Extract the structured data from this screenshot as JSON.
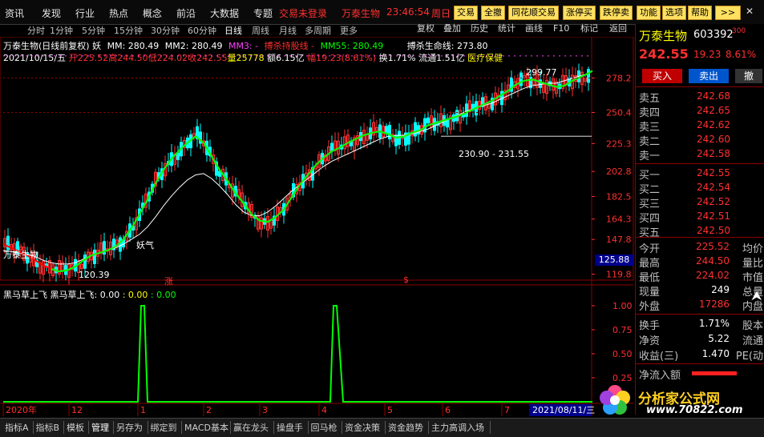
{
  "menu": {
    "items": [
      "资讯",
      "发现",
      "行业",
      "热点",
      "概念",
      "前沿",
      "大数据",
      "专题"
    ],
    "login_status": "交易未登录",
    "stock_name": "万泰生物",
    "clock": "23:46:54",
    "weekday": "周日",
    "buttons": [
      "交易",
      "全撤",
      "同花顺交易",
      "涨停买",
      "跌停卖",
      "功能",
      "选项",
      "帮助",
      ">>"
    ]
  },
  "periods": {
    "items": [
      "分时",
      "1分钟",
      "5分钟",
      "15分钟",
      "30分钟",
      "60分钟",
      "日线",
      "周线",
      "月线",
      "多周期",
      "更多"
    ],
    "selected": "日线"
  },
  "toolbar": {
    "buttons": [
      "复权",
      "叠加",
      "历史",
      "统计",
      "画线",
      "F10",
      "标记",
      "返回"
    ]
  },
  "main_info": {
    "title": "万泰生物(日线前复权)",
    "kind_glyph": "妖",
    "ma1": "MM: 280.49",
    "ma2": "MM2: 280.49",
    "ma3_label": "MM3: -",
    "ma3_text": "搏杀持股线 -",
    "ma55": "MM55: 280.49",
    "life_line": "搏杀生命线: 273.80",
    "date": "2021/10/15/五",
    "open": "开225.52",
    "high": "高244.50",
    "low": "低224.02",
    "close": "收242.55",
    "volume": "量25778",
    "amount": "额6.15亿",
    "amp": "幅19.23(8.61%)",
    "turnover": "换1.71%",
    "float": "流通1.51亿",
    "sector": "医疗保健"
  },
  "annotations": {
    "high_label": "299.77",
    "range_label": "230.90 - 231.55",
    "low_label": "120.39",
    "yao_label": "妖气",
    "marker1": "涨",
    "marker2": "$",
    "current_price_tag": "125.88"
  },
  "indicator": {
    "title": "黑马草上飞 黑马草上飞: 0.00",
    "v1": ": 0.00",
    "v2": ": 0.00"
  },
  "xaxis": {
    "labels": [
      "2020年",
      "12",
      "1",
      "2",
      "3",
      "4",
      "5",
      "6",
      "7"
    ],
    "current_date": "2021/08/11/三"
  },
  "chart_data": [
    {
      "type": "candlestick",
      "title": "万泰生物(日线前复权)",
      "ylim": [
        115,
        305
      ],
      "yticks": [
        278.2,
        250.4,
        225.3,
        202.8,
        182.5,
        164.3,
        147.8,
        119.8
      ],
      "series": [
        {
          "name": "MM2",
          "type": "line",
          "color": "#ffffff",
          "x": [
            0,
            10,
            20,
            30,
            40,
            50,
            60,
            70,
            80,
            90,
            100,
            110,
            120,
            130,
            140,
            150,
            160,
            170,
            180,
            190,
            200,
            210,
            220,
            230,
            240,
            250,
            260,
            270,
            280,
            290,
            300,
            310,
            320,
            330,
            340,
            350,
            360,
            370,
            380,
            390,
            400,
            410,
            420,
            430,
            440,
            450,
            460,
            470,
            480,
            490,
            500,
            510,
            520,
            530,
            540,
            550,
            560,
            570,
            580,
            590,
            600,
            610,
            620,
            630,
            640,
            650,
            660,
            670,
            680,
            690,
            700,
            710,
            720,
            730,
            735
          ],
          "values": [
            139,
            138,
            137,
            136,
            134,
            131,
            129,
            128,
            128,
            129,
            132,
            135,
            137,
            139,
            141,
            144,
            148,
            152,
            158,
            166,
            175,
            183,
            190,
            196,
            200,
            201,
            197,
            191,
            184,
            176,
            170,
            167,
            167,
            170,
            175,
            181,
            187,
            192,
            197,
            202,
            207,
            211,
            214,
            217,
            220,
            223,
            226,
            229,
            231,
            232,
            232,
            233,
            235,
            237,
            240,
            243,
            246,
            249,
            252,
            254,
            256,
            258,
            261,
            264,
            267,
            270,
            272,
            273,
            274,
            274,
            276,
            278,
            280,
            282,
            284
          ]
        },
        {
          "name": "MM",
          "type": "line",
          "color": "#ff0000",
          "x": [
            0,
            10,
            20,
            30,
            40,
            50,
            60,
            70,
            80,
            90,
            100,
            110,
            120,
            130,
            140,
            150,
            160,
            170,
            180,
            190,
            200,
            210,
            220,
            230,
            240,
            250,
            260,
            270,
            280,
            290,
            300,
            310,
            320,
            330,
            340,
            350,
            360,
            370,
            380,
            390,
            400,
            410,
            420,
            430,
            440,
            450,
            460,
            470,
            480,
            490,
            500,
            510,
            520,
            530,
            540,
            550,
            560,
            570,
            580,
            590,
            600,
            610,
            620,
            630,
            640,
            650,
            660,
            670,
            680,
            690,
            700,
            710,
            720,
            730,
            735
          ],
          "values": [
            144,
            141,
            138,
            135,
            131,
            127,
            124,
            122,
            123,
            126,
            131,
            135,
            137,
            139,
            142,
            148,
            157,
            168,
            180,
            193,
            204,
            213,
            220,
            226,
            231,
            226,
            215,
            204,
            195,
            185,
            177,
            168,
            163,
            162,
            166,
            172,
            182,
            192,
            200,
            208,
            214,
            219,
            222,
            226,
            229,
            232,
            234,
            235,
            233,
            230,
            231,
            234,
            236,
            240,
            242,
            244,
            246,
            248,
            251,
            254,
            257,
            260,
            264,
            268,
            273,
            276,
            277,
            275,
            273,
            271,
            272,
            276,
            279,
            282,
            284
          ]
        },
        {
          "name": "MM55",
          "type": "line",
          "color": "#00ff00",
          "x": [
            60,
            70,
            80,
            90,
            100,
            110,
            120,
            130,
            140,
            150,
            160,
            170,
            180,
            190,
            200,
            210,
            220,
            230,
            240,
            250,
            260,
            270,
            280,
            290,
            300,
            310,
            320,
            330,
            340,
            350,
            360,
            370,
            380,
            390,
            400,
            410,
            420,
            430,
            440,
            450,
            460,
            470,
            480,
            490,
            500,
            510,
            520,
            530,
            540,
            550,
            560,
            570,
            580,
            590,
            600,
            610,
            620,
            630,
            640,
            650,
            660,
            670,
            680,
            690,
            700,
            710,
            720,
            730,
            735
          ],
          "values": [
            124,
            122,
            123,
            126,
            131,
            135,
            137,
            139,
            142,
            148,
            157,
            168,
            180,
            193,
            204,
            213,
            220,
            226,
            231,
            226,
            215,
            204,
            195,
            185,
            177,
            168,
            163,
            162,
            166,
            172,
            182,
            192,
            200,
            208,
            214,
            219,
            222,
            226,
            229,
            232,
            234,
            235,
            233,
            230,
            231,
            234,
            236,
            240,
            242,
            244,
            246,
            248,
            251,
            254,
            257,
            260,
            264,
            268,
            273,
            276,
            277,
            275,
            273,
            271,
            272,
            276,
            279,
            282,
            284
          ]
        }
      ]
    },
    {
      "type": "line",
      "title": "黑马草上飞",
      "ylim": [
        0,
        1.1
      ],
      "yticks": [
        1.0,
        0.75,
        0.5,
        0.25
      ],
      "series": [
        {
          "name": "黑马草上飞",
          "color": "#00ff00",
          "x": [
            0,
            168,
            172,
            176,
            180,
            400,
            408,
            412,
            416,
            424,
            735
          ],
          "values": [
            0,
            0,
            1,
            1,
            0,
            0,
            0,
            1,
            1,
            0,
            0
          ]
        }
      ]
    }
  ],
  "panel": {
    "name": "万泰生物",
    "code": "603392",
    "code_sup": "300",
    "price": "242.55",
    "change": "19.23",
    "change_pct": "8.61%",
    "buy_label": "买入",
    "sell_label": "卖出",
    "cancel_label": "撤",
    "asks": [
      {
        "label": "卖五",
        "price": "242.68"
      },
      {
        "label": "卖四",
        "price": "242.65"
      },
      {
        "label": "卖三",
        "price": "242.62"
      },
      {
        "label": "卖二",
        "price": "242.60"
      },
      {
        "label": "卖一",
        "price": "242.58"
      }
    ],
    "bids": [
      {
        "label": "买一",
        "price": "242.55"
      },
      {
        "label": "买二",
        "price": "242.54"
      },
      {
        "label": "买三",
        "price": "242.52"
      },
      {
        "label": "买四",
        "price": "242.51"
      },
      {
        "label": "买五",
        "price": "242.50"
      }
    ],
    "stats": [
      {
        "label": "今开",
        "value": "225.52",
        "right": "均价",
        "color": "#ff3030"
      },
      {
        "label": "最高",
        "value": "244.50",
        "right": "量比",
        "color": "#ff3030"
      },
      {
        "label": "最低",
        "value": "224.02",
        "right": "市值",
        "color": "#ff3030"
      },
      {
        "label": "现量",
        "value": "249",
        "right": "总量",
        "color": "#ffffff"
      },
      {
        "label": "外盘",
        "value": "17286",
        "right": "内盘",
        "color": "#ff3030"
      }
    ],
    "stats2": [
      {
        "label": "换手",
        "value": "1.71%",
        "right": "股本",
        "color": "#ffffff"
      },
      {
        "label": "净资",
        "value": "5.22",
        "right": "流通",
        "color": "#ffffff"
      },
      {
        "label": "收益(三)",
        "value": "1.470",
        "right": "PE(动",
        "color": "#ffffff"
      }
    ],
    "netflow_label": "净流入额"
  },
  "bottom_tabs": [
    "指标A",
    "指标B",
    "模板",
    "管理",
    "另存为",
    "绑定到",
    "MACD基本",
    "赢在龙头",
    "操盘手",
    "回马枪",
    "资金决策",
    "资金趋势",
    "主力高调入场"
  ],
  "bottom_selected": "管理",
  "logo": {
    "text": "分析家公式网",
    "url_text": "www.70822.com"
  },
  "colors": {
    "up": "#ff3030",
    "down": "#00ffff",
    "ma_red": "#ff0000",
    "ma_white": "#ffffff",
    "ma_green": "#00ff00",
    "accent_yellow": "#ffe060"
  }
}
